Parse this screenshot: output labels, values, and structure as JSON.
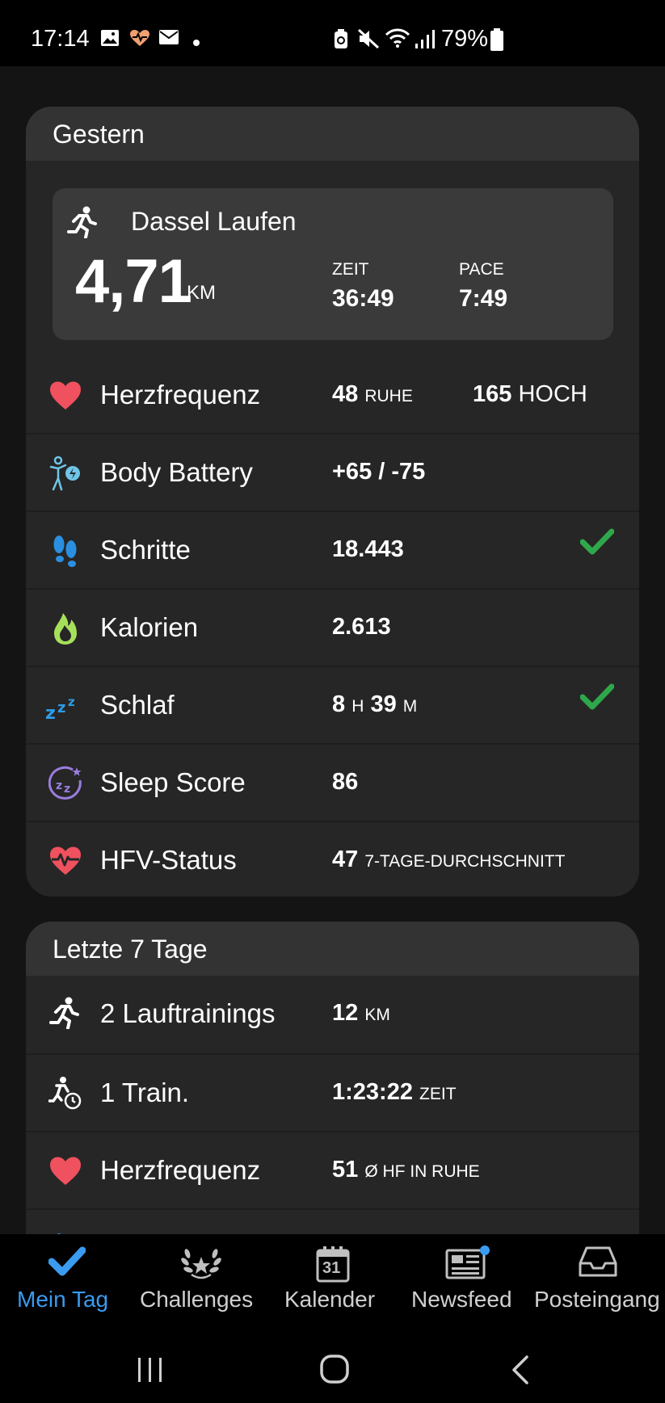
{
  "status_bar": {
    "time": "17:14",
    "battery": "79%",
    "icons": [
      "image-icon",
      "heart-app-icon",
      "mail-icon",
      "dot-icon",
      "battery-saver-icon",
      "mute-icon",
      "wifi-icon",
      "signal-icon",
      "battery-icon"
    ]
  },
  "yesterday": {
    "title": "Gestern",
    "activity": {
      "name": "Dassel Laufen",
      "distance": "4,71",
      "distance_unit": "KM",
      "time_label": "ZEIT",
      "time_value": "36:49",
      "pace_label": "PACE",
      "pace_value": "7:49"
    },
    "rows": [
      {
        "label": "Herzfrequenz",
        "value": "48",
        "unit": "RUHE",
        "value2": "165",
        "unit2": "HOCH"
      },
      {
        "label": "Body Battery",
        "value": "+65 / -75"
      },
      {
        "label": "Schritte",
        "value": "18.443",
        "check": true
      },
      {
        "label": "Kalorien",
        "value": "2.613"
      },
      {
        "label": "Schlaf",
        "h_value": "8",
        "h_unit": "H",
        "m_value": "39",
        "m_unit": "M",
        "check": true
      },
      {
        "label": "Sleep Score",
        "value": "86"
      },
      {
        "label": "HFV-Status",
        "value": "47",
        "unit": "7-TAGE-DURCHSCHNITT"
      }
    ]
  },
  "last7": {
    "title": "Letzte 7 Tage",
    "rows": [
      {
        "label": "2 Lauftrainings",
        "value": "12",
        "unit": "KM"
      },
      {
        "label": "1 Train.",
        "value": "1:23:22",
        "unit": "ZEIT"
      },
      {
        "label": "Herzfrequenz",
        "value": "51",
        "unit": "Ø HF IN RUHE"
      }
    ]
  },
  "colors": {
    "accent": "#3a9bf0",
    "heart": "#f0515f",
    "check": "#2ea84a",
    "steps": "#2a8fe0",
    "calories": "#a6e05a",
    "sleep": "#2e9ce6",
    "sleep_score": "#9a7de0",
    "body_battery": "#6fc6e8"
  },
  "nav": {
    "items": [
      {
        "label": "Mein Tag",
        "icon": "check-icon",
        "active": true
      },
      {
        "label": "Challenges",
        "icon": "laurel-icon"
      },
      {
        "label": "Kalender",
        "icon": "calendar-icon",
        "day": "31"
      },
      {
        "label": "Newsfeed",
        "icon": "newspaper-icon"
      },
      {
        "label": "Posteingang",
        "icon": "inbox-icon"
      }
    ]
  },
  "system_nav": [
    "recents-icon",
    "home-icon",
    "back-icon"
  ]
}
